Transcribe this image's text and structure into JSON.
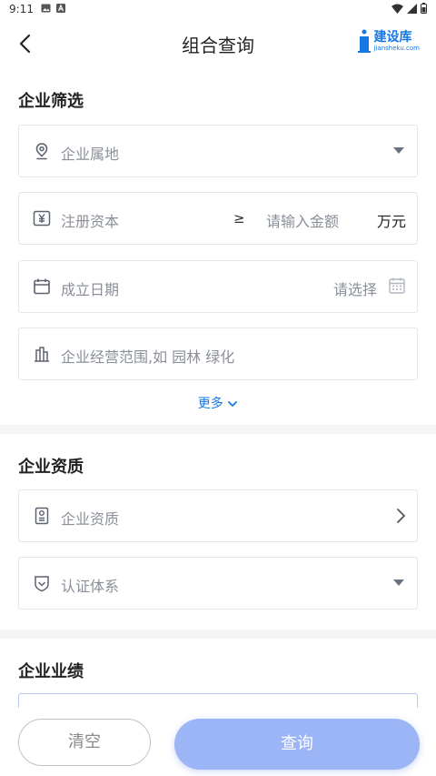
{
  "status": {
    "time": "9:11"
  },
  "nav": {
    "title": "组合查询",
    "logo_name": "建设库",
    "logo_sub": "jiansheku.com"
  },
  "filter": {
    "section_title": "企业筛选",
    "location_label": "企业属地",
    "capital_label": "注册资本",
    "capital_operator": "≥",
    "capital_placeholder": "请输入金额",
    "capital_unit": "万元",
    "date_label": "成立日期",
    "date_select": "请选择",
    "scope_placeholder": "企业经营范围,如 园林 绿化",
    "more_label": "更多"
  },
  "qualification": {
    "section_title": "企业资质",
    "qual_label": "企业资质",
    "cert_label": "认证体系"
  },
  "performance": {
    "section_title": "企业业绩"
  },
  "actions": {
    "clear_label": "清空",
    "query_label": "查询"
  },
  "colors": {
    "accent": "#1677e5",
    "query_button": "#9bb5f6",
    "divider": "#f4f5f7"
  }
}
